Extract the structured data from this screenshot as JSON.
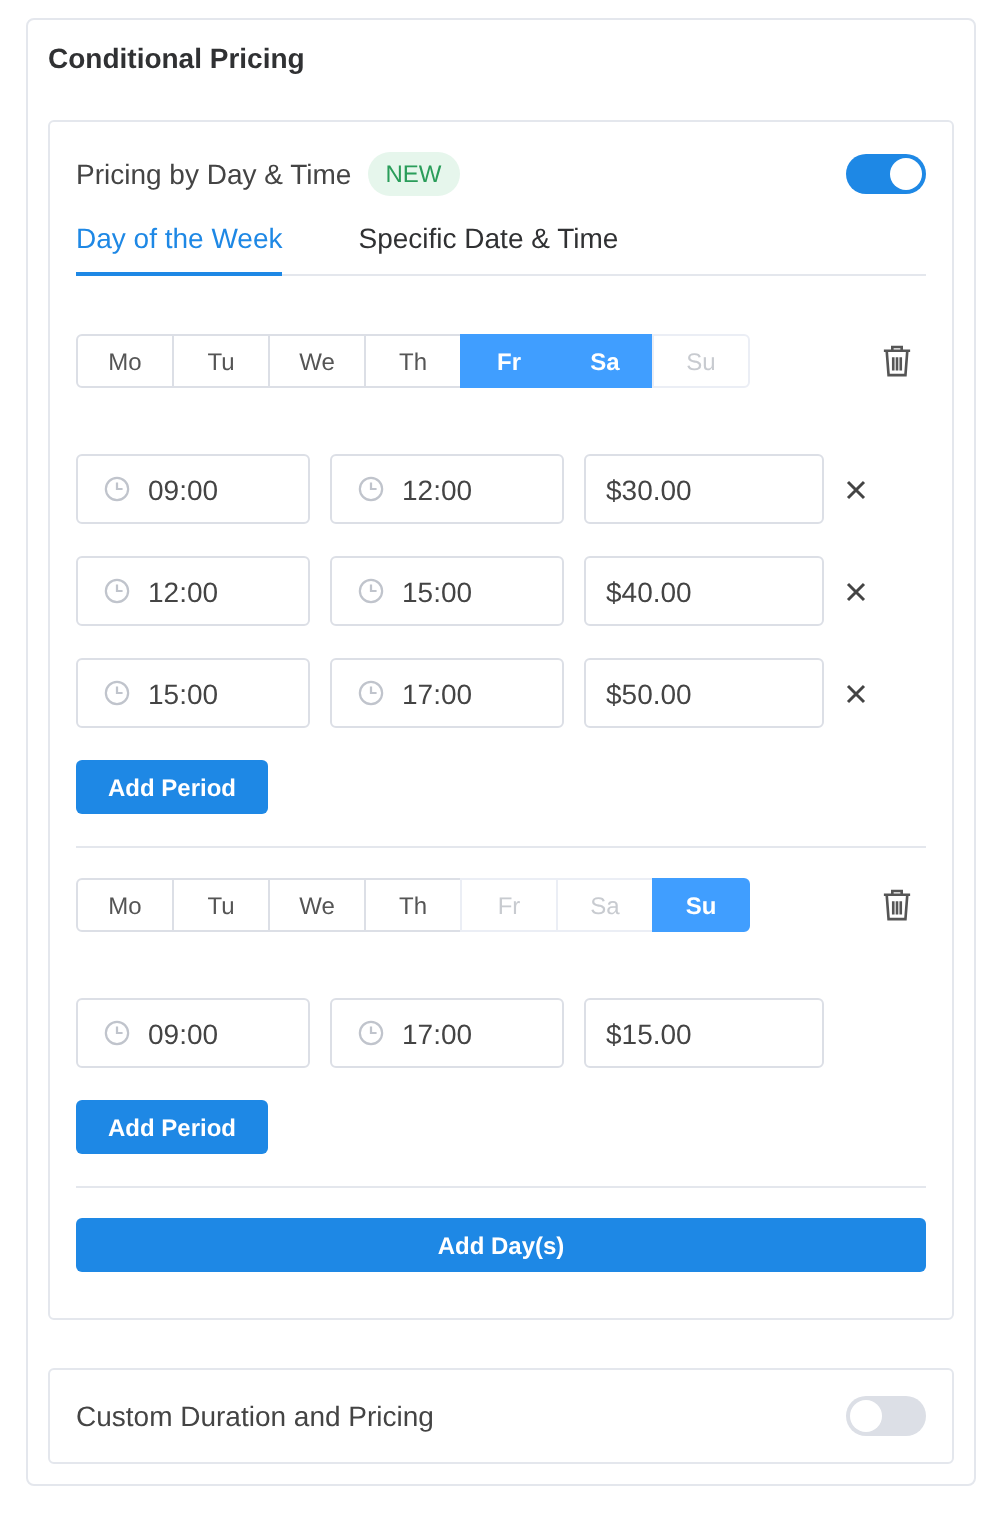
{
  "title": "Conditional Pricing",
  "day_time": {
    "label": "Pricing by Day & Time",
    "badge": "NEW",
    "on": true,
    "tabs": [
      {
        "label": "Day of the Week",
        "selected": true
      },
      {
        "label": "Specific Date & Time",
        "selected": false
      }
    ],
    "groups": [
      {
        "days": [
          {
            "label": "Mo",
            "selected": false,
            "disabled": false
          },
          {
            "label": "Tu",
            "selected": false,
            "disabled": false
          },
          {
            "label": "We",
            "selected": false,
            "disabled": false
          },
          {
            "label": "Th",
            "selected": false,
            "disabled": false
          },
          {
            "label": "Fr",
            "selected": true,
            "disabled": false
          },
          {
            "label": "Sa",
            "selected": true,
            "disabled": false
          },
          {
            "label": "Su",
            "selected": false,
            "disabled": true
          }
        ],
        "periods": [
          {
            "start": "09:00",
            "end": "12:00",
            "price": "$30.00",
            "removable": true
          },
          {
            "start": "12:00",
            "end": "15:00",
            "price": "$40.00",
            "removable": true
          },
          {
            "start": "15:00",
            "end": "17:00",
            "price": "$50.00",
            "removable": true
          }
        ],
        "add_button": "Add Period"
      },
      {
        "days": [
          {
            "label": "Mo",
            "selected": false,
            "disabled": false
          },
          {
            "label": "Tu",
            "selected": false,
            "disabled": false
          },
          {
            "label": "We",
            "selected": false,
            "disabled": false
          },
          {
            "label": "Th",
            "selected": false,
            "disabled": false
          },
          {
            "label": "Fr",
            "selected": false,
            "disabled": true
          },
          {
            "label": "Sa",
            "selected": false,
            "disabled": true
          },
          {
            "label": "Su",
            "selected": true,
            "disabled": false
          }
        ],
        "periods": [
          {
            "start": "09:00",
            "end": "17:00",
            "price": "$15.00",
            "removable": false
          }
        ],
        "add_button": "Add Period"
      }
    ],
    "add_days_button": "Add Day(s)"
  },
  "custom_duration": {
    "label": "Custom Duration and Pricing",
    "on": false
  }
}
